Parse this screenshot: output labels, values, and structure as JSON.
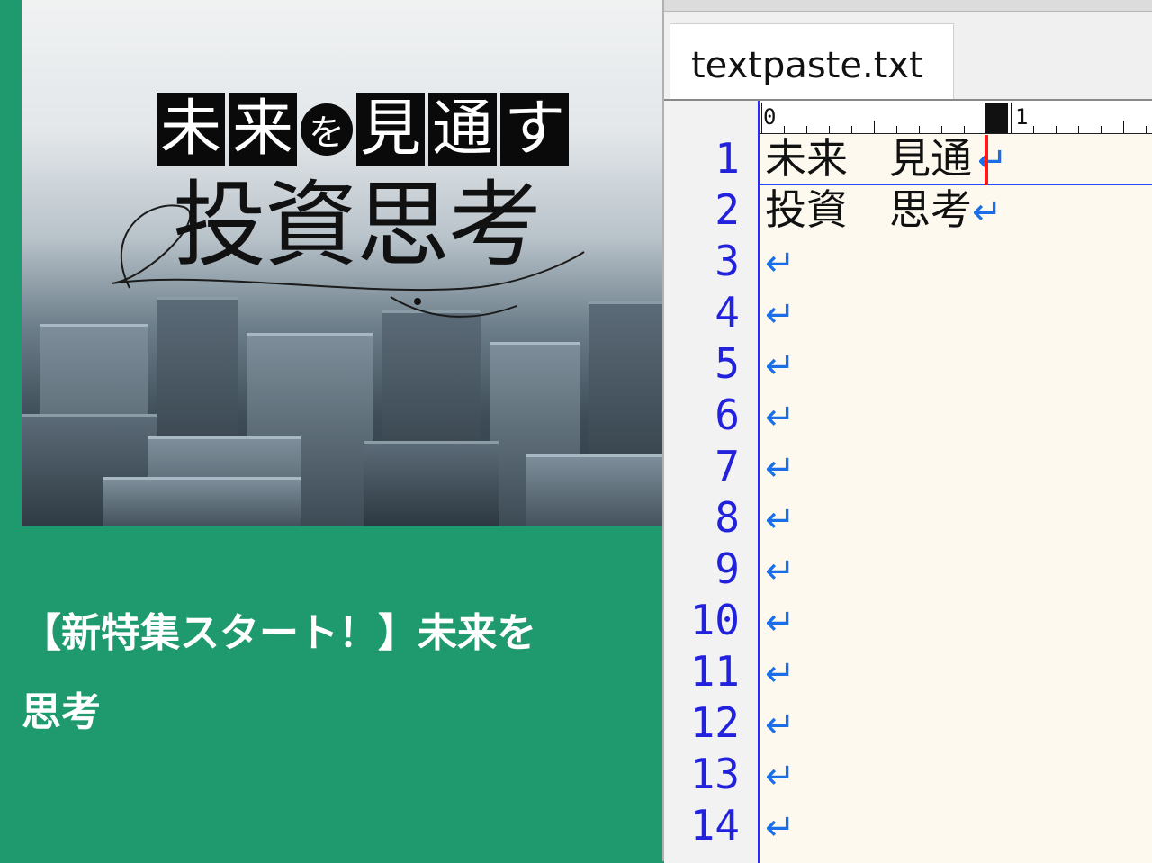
{
  "web": {
    "hero": {
      "title_chars": [
        "未",
        "来",
        "を",
        "見",
        "通",
        "す"
      ],
      "subtitle": "投資思考"
    },
    "headline": "【新特集スタート！】未来を\n思考"
  },
  "editor": {
    "tab_label": "textpaste.txt",
    "ruler": {
      "label_0": "0",
      "label_1": "1"
    },
    "lines": [
      {
        "num": "1",
        "text": "未来　見通",
        "eol": "↵"
      },
      {
        "num": "2",
        "text": "投資　思考",
        "eol": "↵"
      },
      {
        "num": "3",
        "text": "",
        "eol": "↵"
      },
      {
        "num": "4",
        "text": "",
        "eol": "↵"
      },
      {
        "num": "5",
        "text": "",
        "eol": "↵"
      },
      {
        "num": "6",
        "text": "",
        "eol": "↵"
      },
      {
        "num": "7",
        "text": "",
        "eol": "↵"
      },
      {
        "num": "8",
        "text": "",
        "eol": "↵"
      },
      {
        "num": "9",
        "text": "",
        "eol": "↵"
      },
      {
        "num": "10",
        "text": "",
        "eol": "↵"
      },
      {
        "num": "11",
        "text": "",
        "eol": "↵"
      },
      {
        "num": "12",
        "text": "",
        "eol": "↵"
      },
      {
        "num": "13",
        "text": "",
        "eol": "↵"
      },
      {
        "num": "14",
        "text": "",
        "eol": "↵"
      }
    ],
    "colors": {
      "line_number": "#2222dd",
      "eol_mark": "#1a6fe8",
      "caret": "#ff1a1a",
      "text_bg": "#fdf9ef"
    }
  },
  "colors": {
    "page_bg": "#1e9a6e"
  }
}
